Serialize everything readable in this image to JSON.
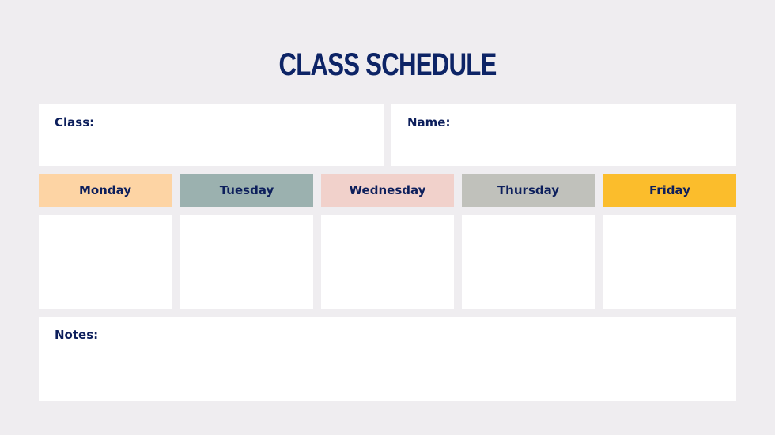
{
  "title": "CLASS SCHEDULE",
  "fields": {
    "class_label": "Class:",
    "class_value": "",
    "name_label": "Name:",
    "name_value": "",
    "notes_label": "Notes:",
    "notes_value": ""
  },
  "days": [
    {
      "label": "Monday",
      "color": "#fdd4a4",
      "content": ""
    },
    {
      "label": "Tuesday",
      "color": "#9bb1af",
      "content": ""
    },
    {
      "label": "Wednesday",
      "color": "#f1d1cb",
      "content": ""
    },
    {
      "label": "Thursday",
      "color": "#c0c1bb",
      "content": ""
    },
    {
      "label": "Friday",
      "color": "#fbbd2c",
      "content": ""
    }
  ]
}
